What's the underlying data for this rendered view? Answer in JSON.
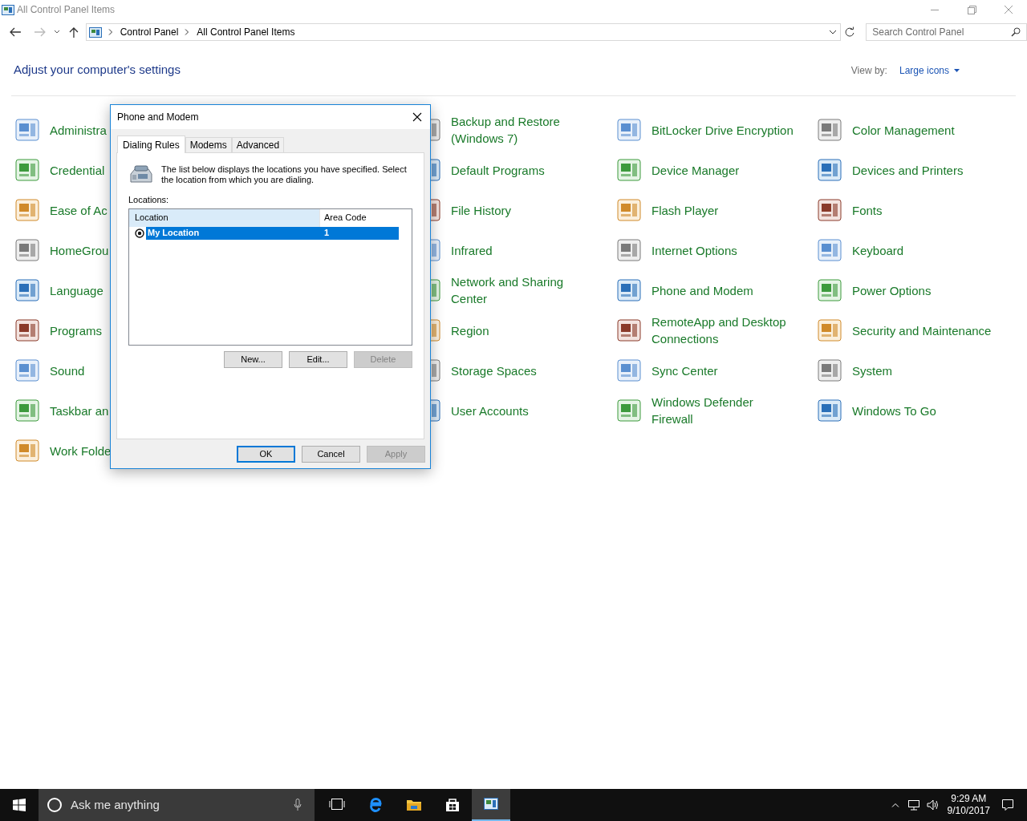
{
  "window": {
    "title": "All Control Panel Items"
  },
  "address": {
    "crumbs": [
      "Control Panel",
      "All Control Panel Items"
    ]
  },
  "search": {
    "placeholder": "Search Control Panel"
  },
  "heading": "Adjust your computer's settings",
  "view_by": {
    "label": "View by:",
    "value": "Large icons"
  },
  "columns": [
    [
      {
        "label": "Administra"
      },
      {
        "label": "Credential"
      },
      {
        "label": "Ease of Ac"
      },
      {
        "label": "HomeGrou"
      },
      {
        "label": "Language"
      },
      {
        "label": "Programs"
      },
      {
        "label": "Sound"
      },
      {
        "label": "Taskbar an"
      },
      {
        "label": "Work Folde"
      }
    ],
    [
      {
        "label": "Backup and Restore\n(Windows 7)"
      },
      {
        "label": "Default Programs"
      },
      {
        "label": "File History"
      },
      {
        "label": "Infrared"
      },
      {
        "label": "Network and Sharing\nCenter"
      },
      {
        "label": "Region"
      },
      {
        "label": "Storage Spaces"
      },
      {
        "label": "User Accounts"
      }
    ],
    [
      {
        "label": "BitLocker Drive Encryption"
      },
      {
        "label": "Device Manager"
      },
      {
        "label": "Flash Player"
      },
      {
        "label": "Internet Options"
      },
      {
        "label": "Phone and Modem"
      },
      {
        "label": "RemoteApp and Desktop\nConnections"
      },
      {
        "label": "Sync Center"
      },
      {
        "label": "Windows Defender\nFirewall"
      }
    ],
    [
      {
        "label": "Color Management"
      },
      {
        "label": "Devices and Printers"
      },
      {
        "label": "Fonts"
      },
      {
        "label": "Keyboard"
      },
      {
        "label": "Power Options"
      },
      {
        "label": "Security and Maintenance"
      },
      {
        "label": "System"
      },
      {
        "label": "Windows To Go"
      }
    ]
  ],
  "dialog": {
    "title": "Phone and Modem",
    "tabs": [
      {
        "label": "Dialing Rules",
        "selected": true
      },
      {
        "label": "Modems",
        "selected": false
      },
      {
        "label": "Advanced",
        "selected": false
      }
    ],
    "description": "The list below displays the locations you have specified. Select the location from which you are dialing.",
    "list_label": "Locations:",
    "table": {
      "columns": [
        "Location",
        "Area Code"
      ],
      "rows": [
        {
          "location": "My Location",
          "area_code": "1",
          "selected": true
        }
      ]
    },
    "list_buttons": [
      {
        "label": "New...",
        "disabled": false
      },
      {
        "label": "Edit...",
        "disabled": false
      },
      {
        "label": "Delete",
        "disabled": true
      }
    ],
    "buttons": [
      {
        "label": "OK",
        "disabled": false,
        "default": true
      },
      {
        "label": "Cancel",
        "disabled": false,
        "default": false
      },
      {
        "label": "Apply",
        "disabled": true,
        "default": false
      }
    ]
  },
  "taskbar": {
    "search_placeholder": "Ask me anything",
    "apps": [
      {
        "kind": "task-view",
        "selected": false
      },
      {
        "kind": "browser",
        "selected": false
      },
      {
        "kind": "folder",
        "selected": false
      },
      {
        "kind": "store",
        "selected": false
      },
      {
        "kind": "control-panel",
        "selected": true
      }
    ],
    "time": "9:29 AM",
    "date": "9/10/2017"
  }
}
